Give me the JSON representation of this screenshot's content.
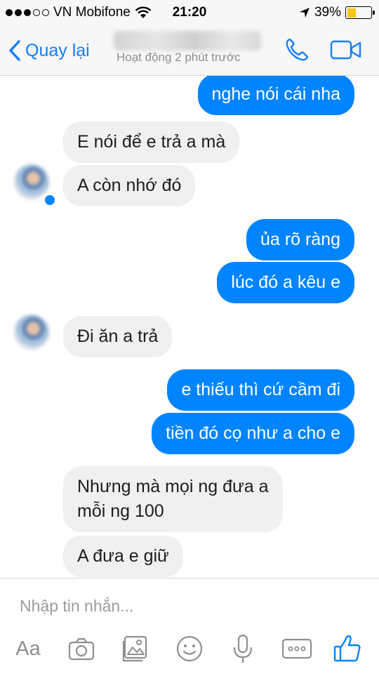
{
  "status_bar": {
    "carrier": "VN Mobifone",
    "time": "21:20",
    "battery_percent": "39%",
    "battery_level": 0.39,
    "signal_bars": 3,
    "battery_color": "#f5c518"
  },
  "nav": {
    "back_label": "Quay lại",
    "contact_status": "Hoạt động 2 phút trước",
    "accent_color": "#157efb",
    "icons": [
      "chevron-left-icon",
      "phone-icon",
      "video-camera-icon"
    ]
  },
  "messages": [
    {
      "side": "out",
      "text": "nghe nói cái nha"
    },
    {
      "side": "in",
      "text": "E nói để e trả a mà"
    },
    {
      "side": "in",
      "text": "A còn nhớ đó"
    },
    {
      "side": "out",
      "text": "ủa rõ ràng"
    },
    {
      "side": "out",
      "text": "lúc đó a kêu e"
    },
    {
      "side": "in",
      "text": "Đi ăn a trả"
    },
    {
      "side": "out",
      "text": "e thiếu thì cứ cầm đi"
    },
    {
      "side": "out",
      "text": "tiền đó cọ như a cho e"
    },
    {
      "side": "in",
      "line1": "Nhưng mà mọi ng đưa a",
      "line2": "mỗi ng 100"
    },
    {
      "side": "in",
      "text": "A đưa e giữ"
    }
  ],
  "compose": {
    "placeholder": "Nhập tin nhắn...",
    "aa_label": "Aa",
    "tools": [
      "text-format-icon",
      "camera-icon",
      "photo-gallery-icon",
      "emoji-icon",
      "microphone-icon",
      "more-icon",
      "like-icon"
    ]
  },
  "colors": {
    "outgoing_bubble": "#0084ff",
    "incoming_bubble": "#f1f0f0",
    "icon_gray": "#8e8e93"
  }
}
